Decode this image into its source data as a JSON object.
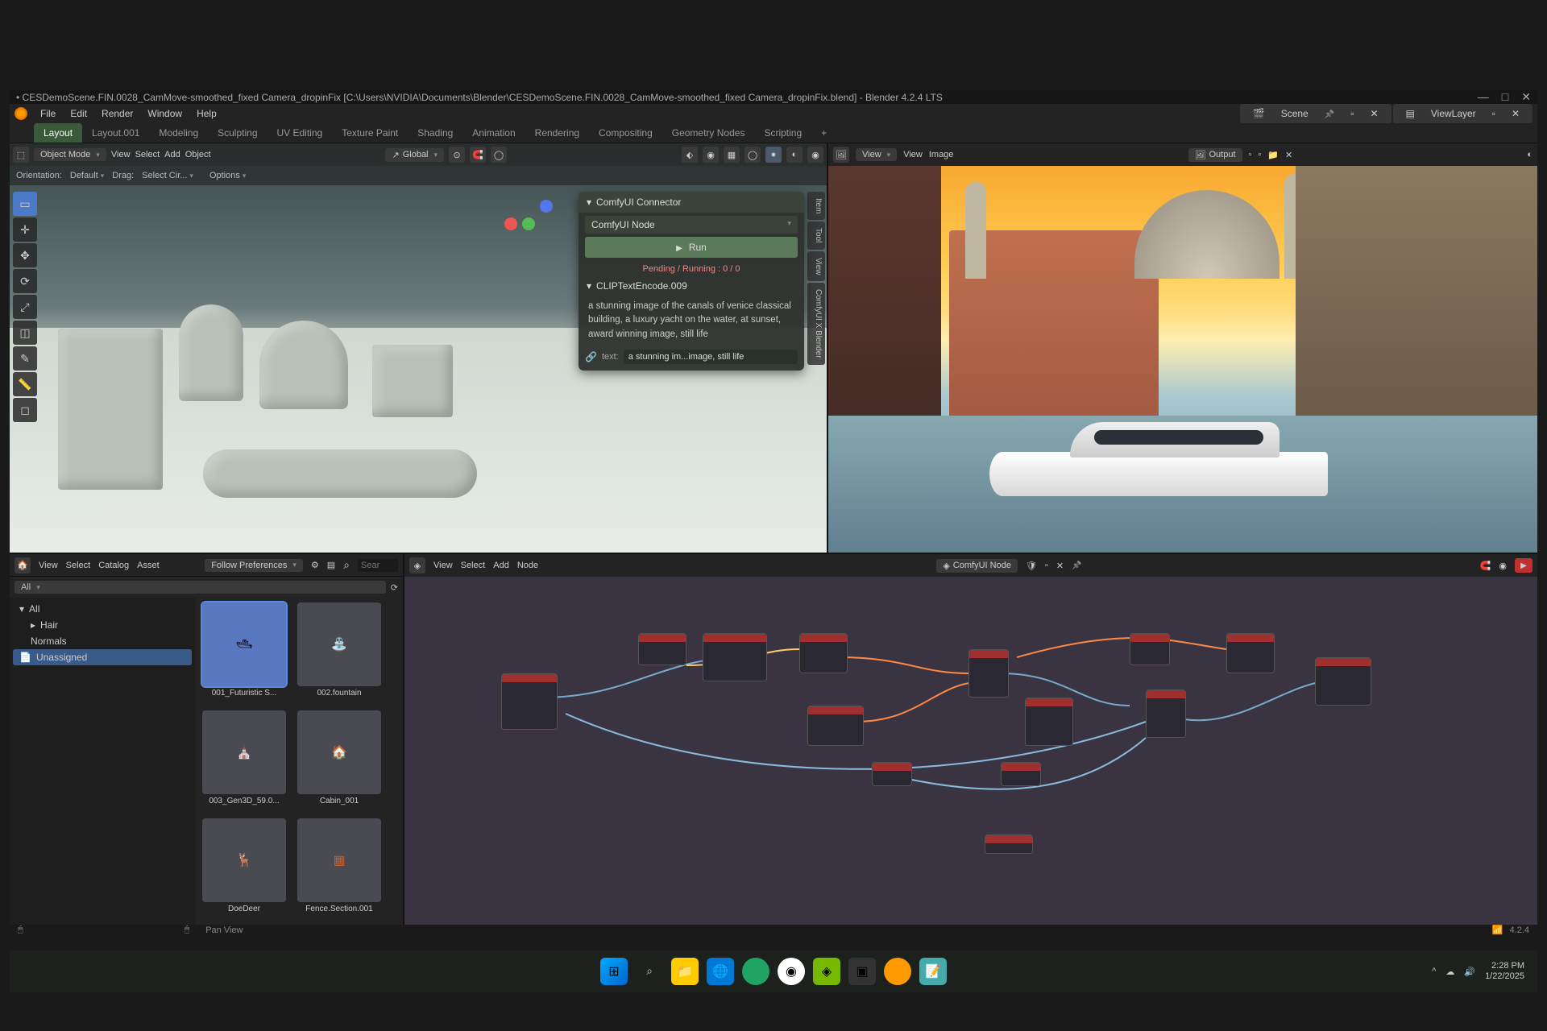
{
  "app": {
    "title": "• CESDemoScene.FIN.0028_CamMove-smoothed_fixed Camera_dropinFix [C:\\Users\\NVIDIA\\Documents\\Blender\\CESDemoScene.FIN.0028_CamMove-smoothed_fixed Camera_dropinFix.blend] - Blender 4.2.4 LTS"
  },
  "menu": {
    "file": "File",
    "edit": "Edit",
    "render": "Render",
    "window": "Window",
    "help": "Help"
  },
  "scene_slot": {
    "label": "Scene",
    "layer": "ViewLayer"
  },
  "workspaces": [
    "Layout",
    "Layout.001",
    "Modeling",
    "Sculpting",
    "UV Editing",
    "Texture Paint",
    "Shading",
    "Animation",
    "Rendering",
    "Compositing",
    "Geometry Nodes",
    "Scripting",
    "+"
  ],
  "viewport": {
    "mode": "Object Mode",
    "menus": {
      "view": "View",
      "select": "Select",
      "add": "Add",
      "object": "Object"
    },
    "orient": "Global",
    "subheader": {
      "orientation": "Orientation:",
      "orientation_val": "Default",
      "drag": "Drag:",
      "drag_val": "Select Cir...",
      "options": "Options"
    }
  },
  "comfy": {
    "title": "ComfyUI Connector",
    "node_label": "ComfyUI Node",
    "run": "Run",
    "status": "Pending / Running : 0 / 0",
    "section": "CLIPTextEncode.009",
    "prompt": "a stunning image of the canals of venice classical building, a luxury yacht on the water, at sunset,  award winning image, still life",
    "text_label": "text:",
    "text_value": "a stunning im...image, still life"
  },
  "vtabs": [
    "Item",
    "Tool",
    "View",
    "ComfyUI X Blender"
  ],
  "image_editor": {
    "menus": {
      "view": "View",
      "view2": "View",
      "image": "Image"
    },
    "slot": "Output"
  },
  "asset_browser": {
    "menus": {
      "view": "View",
      "select": "Select",
      "catalog": "Catalog",
      "asset": "Asset"
    },
    "follow": "Follow Preferences",
    "search": "Sear",
    "filter_all": "All",
    "tree": {
      "all": "All",
      "hair": "Hair",
      "normals": "Normals",
      "unassigned": "Unassigned"
    },
    "assets": [
      {
        "name": "001_Futuristic S...",
        "sel": true
      },
      {
        "name": "002.fountain",
        "sel": false
      },
      {
        "name": "003_Gen3D_59.0...",
        "sel": false
      },
      {
        "name": "Cabin_001",
        "sel": false
      },
      {
        "name": "DoeDeer",
        "sel": false
      },
      {
        "name": "Fence.Section.001",
        "sel": false
      }
    ]
  },
  "node_editor": {
    "menus": {
      "view": "View",
      "select": "Select",
      "add": "Add",
      "node": "Node"
    },
    "slot": "ComfyUI Node"
  },
  "statusbar": {
    "hint": "Pan View",
    "version": "4.2.4"
  },
  "taskbar": {
    "time": "2:28 PM",
    "date": "1/22/2025"
  }
}
